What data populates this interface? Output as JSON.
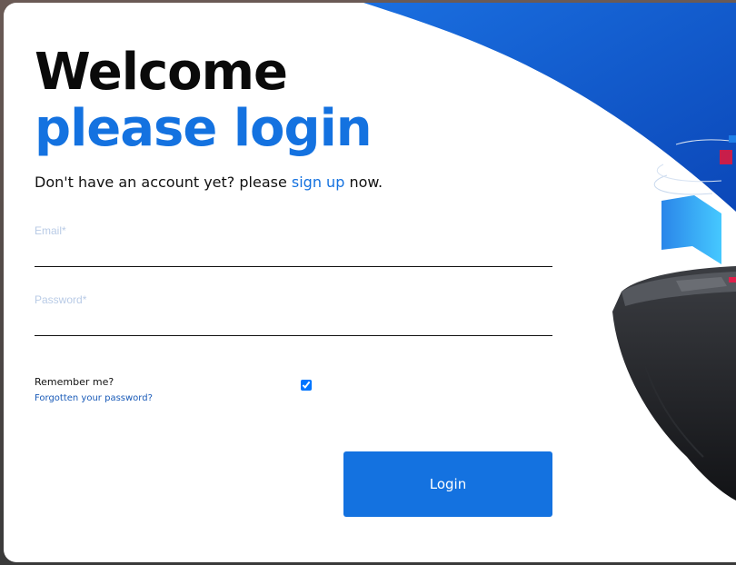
{
  "header": {
    "title_line1": "Welcome",
    "title_line2": "please login"
  },
  "signup_prompt": {
    "before": "Don't have an account yet? please ",
    "link": "sign up",
    "after": " now."
  },
  "form": {
    "email_label": "Email*",
    "email_value": "",
    "password_label": "Password*",
    "password_value": "",
    "remember_label": "Remember me?",
    "remember_checked": true,
    "forgot_link": "Forgotten your password?",
    "login_label": "Login"
  },
  "colors": {
    "accent": "#1472e0",
    "title": "#0a0a0a",
    "field_label": "#b9cbe6"
  }
}
